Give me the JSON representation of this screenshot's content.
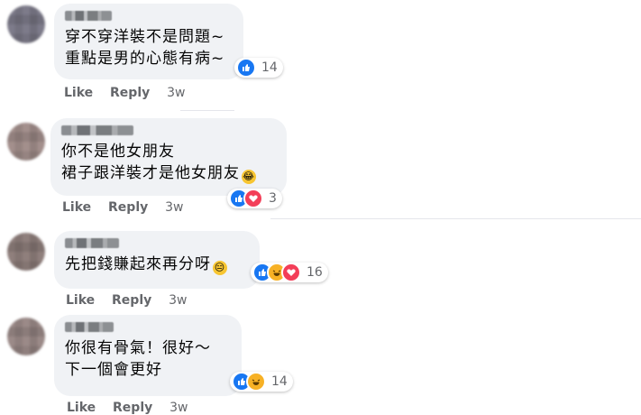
{
  "comments": [
    {
      "lines": [
        "穿不穿洋裝不是問題~",
        "重點是男的心態有病~"
      ],
      "actions": {
        "like": "Like",
        "reply": "Reply",
        "time": "3w"
      },
      "reactions": {
        "types": [
          "like"
        ],
        "count": "14"
      },
      "avatar_color": "#7d7b8a"
    },
    {
      "lines": [
        "你不是他女朋友",
        "裙子跟洋裝才是他女朋友"
      ],
      "trailing_emoji": "laugh-tears-emoji",
      "actions": {
        "like": "Like",
        "reply": "Reply",
        "time": "3w"
      },
      "reactions": {
        "types": [
          "like",
          "love"
        ],
        "count": "3"
      },
      "avatar_color": "#a38f8c"
    },
    {
      "lines": [
        "先把錢賺起來再分呀"
      ],
      "trailing_emoji": "unamused-emoji",
      "actions": {
        "like": "Like",
        "reply": "Reply",
        "time": "3w"
      },
      "reactions": {
        "types": [
          "like",
          "haha",
          "love"
        ],
        "count": "16"
      },
      "avatar_color": "#8f7f7c"
    },
    {
      "lines": [
        "你很有骨氣！很好～",
        "下一個會更好"
      ],
      "actions": {
        "like": "Like",
        "reply": "Reply",
        "time": "3w"
      },
      "reactions": {
        "types": [
          "like",
          "haha"
        ],
        "count": "14"
      },
      "avatar_color": "#9b8a88"
    }
  ]
}
